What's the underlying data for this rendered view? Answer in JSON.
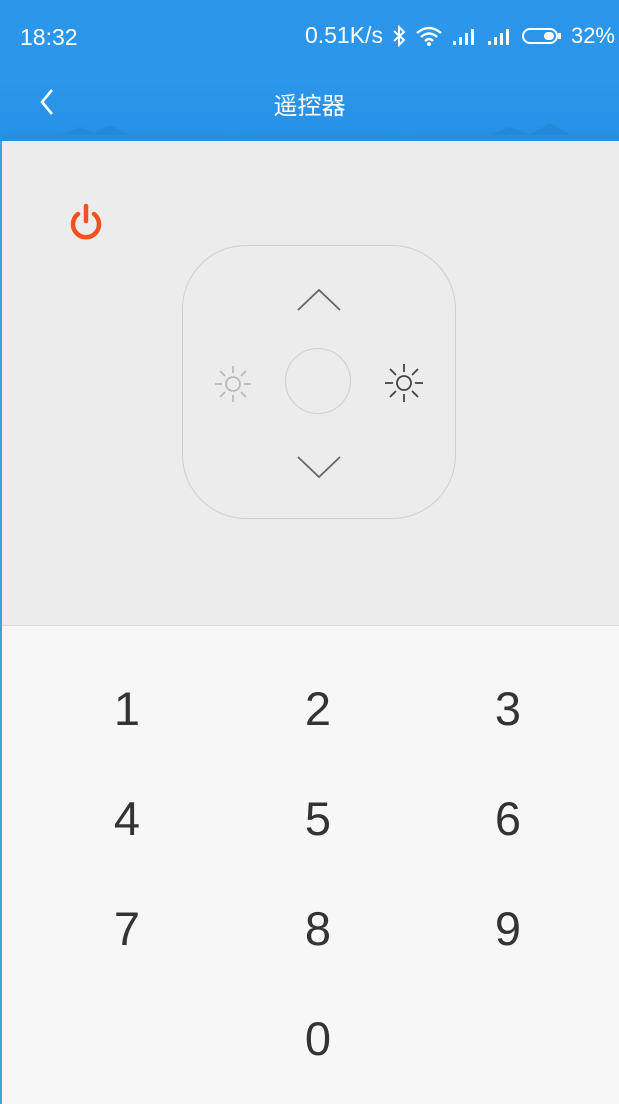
{
  "status": {
    "time": "18:32",
    "speed": "0.51K/s",
    "battery": "32%",
    "icons": [
      "bluetooth-icon",
      "wifi-icon",
      "signal-icon",
      "signal-icon",
      "battery-icon"
    ]
  },
  "appbar": {
    "title": "遥控器",
    "back_icon": "chevron-left-icon"
  },
  "remote": {
    "power_icon": "power-icon",
    "up_icon": "chevron-up-icon",
    "down_icon": "chevron-down-icon",
    "dim_icon": "sun-dim-icon",
    "bright_icon": "sun-bright-icon"
  },
  "keypad": {
    "keys": [
      "1",
      "2",
      "3",
      "4",
      "5",
      "6",
      "7",
      "8",
      "9",
      "0"
    ]
  },
  "colors": {
    "accent": "#2c96ea",
    "power": "#f4511e"
  }
}
